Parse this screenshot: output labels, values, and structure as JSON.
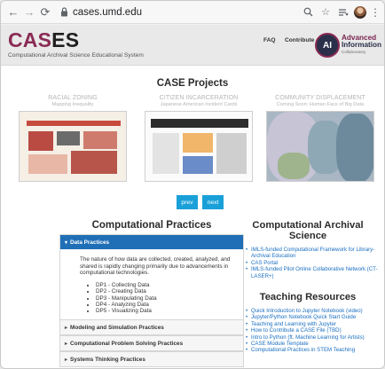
{
  "browser": {
    "url": "cases.umd.edu",
    "icons": [
      "back-arrow-icon",
      "forward-arrow-icon",
      "reload-icon",
      "lock-icon",
      "zoom-icon",
      "star-icon",
      "reading-list-icon",
      "profile-avatar",
      "more-icon"
    ]
  },
  "header": {
    "logo_part1": "CAS",
    "logo_part2": "ES",
    "tagline": "Computational Archival Science Educational System",
    "nav": [
      "FAQ",
      "Contribute"
    ],
    "partner_badge": "AI",
    "partner_line1": "Advanced",
    "partner_line2": "Information",
    "partner_line3": "Collaboratory"
  },
  "projects": {
    "title": "CASE Projects",
    "cards": [
      {
        "title": "RACIAL ZONING",
        "subtitle": "Mapping Inequality"
      },
      {
        "title": "CITIZEN INCARCERATION",
        "subtitle": "Japanese American Incident Cards"
      },
      {
        "title": "COMMUNITY DISPLACEMENT",
        "subtitle": "Coming Soon: Human Face of Big Data"
      }
    ],
    "prev_label": "prev",
    "next_label": "next"
  },
  "practices": {
    "title": "Computational Practices",
    "open_label": "Data Practices",
    "description": "The nature of how data are collected, created, analyzed, and shared is rapidly changing primarily due to advancements in computational technologies.",
    "items": [
      "DP1 - Collecting Data",
      "DP2 - Creating Data",
      "DP3 - Manipulating Data",
      "DP4 - Analyzing Data",
      "DP5 - Visualizing Data"
    ],
    "collapsed": [
      "Modeling and Simulation Practices",
      "Computational Problem Solving Practices",
      "Systems Thinking Practices"
    ]
  },
  "science": {
    "title_line1": "Computational Archival",
    "title_line2": "Science",
    "links": [
      "IMLS-funded Computational Framework for Library-Archival Education",
      "CAS Portal",
      "IMLS-funded Pilot Online Collaborative Network (CT-LASER+)"
    ]
  },
  "teaching": {
    "title": "Teaching Resources",
    "links": [
      "Quick Introduction to Jupyter Notebook (video)",
      "Jupyter/Python Notebook Quick Start Guide",
      "Teaching and Learning with Jupyter",
      "How to Contribute a CASE File (TBD)",
      "Intro to Python (ft. Machine Learning for Artists)",
      "CASE Module Template",
      "Computational Practices in STEM Teaching"
    ]
  },
  "colors": {
    "brand_maroon": "#8a2b55",
    "accordion_blue": "#1f6fb6",
    "button_blue": "#1aa0d8",
    "link_blue": "#1a6fc1"
  }
}
